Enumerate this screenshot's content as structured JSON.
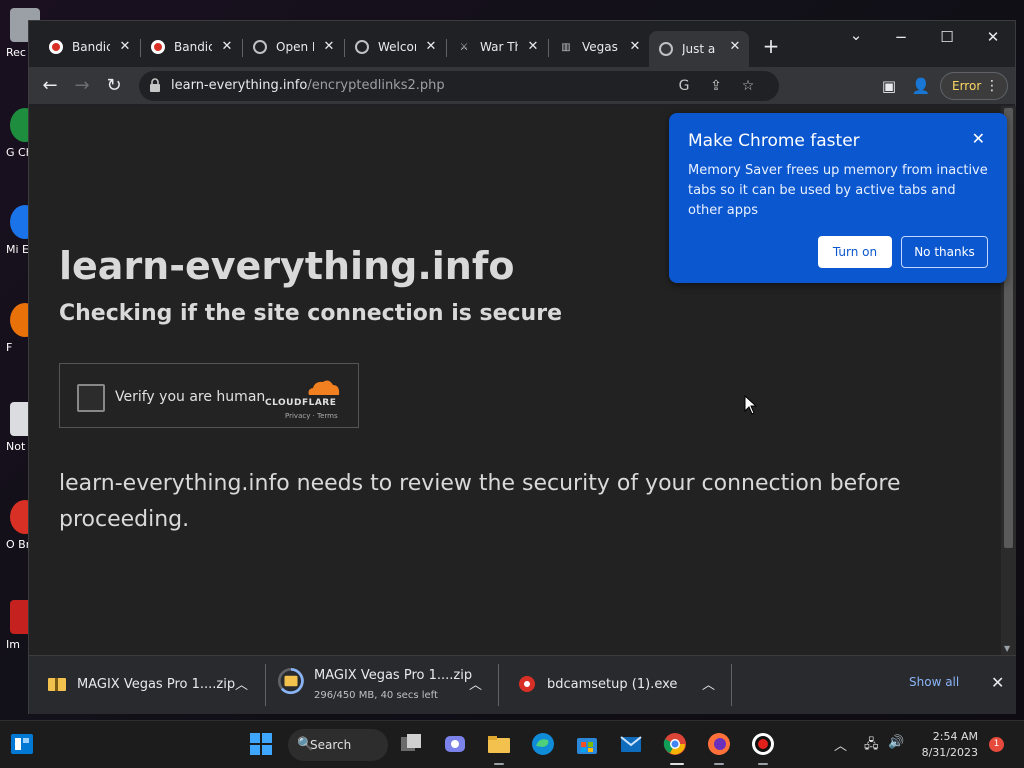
{
  "desktop": {
    "icons": [
      {
        "label": "Rec",
        "color": "#9aa0a6"
      },
      {
        "label": "G Ch",
        "color": "#1e8e3e"
      },
      {
        "label": "Mi E",
        "color": "#1a73e8"
      },
      {
        "label": "F",
        "color": "#e8710a"
      },
      {
        "label": "Not",
        "color": "#dadce0"
      },
      {
        "label": "O Br",
        "color": "#d93025"
      },
      {
        "label": "Im",
        "color": "#c5221f"
      }
    ]
  },
  "tabs": [
    {
      "title": "Bandic",
      "favicon": "record-icon",
      "color": "#d93025"
    },
    {
      "title": "Bandic",
      "favicon": "record-icon",
      "color": "#d93025"
    },
    {
      "title": "Open E",
      "favicon": "openai-icon",
      "color": "#bdc1c6"
    },
    {
      "title": "Welcon",
      "favicon": "globe-icon",
      "color": "#bdc1c6"
    },
    {
      "title": "War Th",
      "favicon": "sword-icon",
      "color": "#bdc1c6"
    },
    {
      "title": "Vegas",
      "favicon": "building-icon",
      "color": "#bdc1c6"
    },
    {
      "title": "Just a r",
      "favicon": "globe-icon",
      "color": "#bdc1c6",
      "active": true
    }
  ],
  "toolbar": {
    "url_host": "learn-everything.info",
    "url_path": "/encryptedlinks2.php",
    "error_label": "Error"
  },
  "page": {
    "title": "learn-everything.info",
    "subtitle": "Checking if the site connection is secure",
    "verify_label": "Verify you are human",
    "cloudflare_name": "CLOUDFLARE",
    "cloudflare_links": "Privacy  ·  Terms",
    "review_text": "learn-everything.info needs to review the security of your connection before proceeding."
  },
  "popup": {
    "title": "Make Chrome faster",
    "body": "Memory Saver frees up memory from inactive tabs so it can be used by active tabs and other apps",
    "turn_on": "Turn on",
    "no_thanks": "No thanks"
  },
  "downloads": {
    "items": [
      {
        "name": "MAGIX Vegas Pro 1....zip",
        "status": ""
      },
      {
        "name": "MAGIX Vegas Pro 1....zip",
        "status": "296/450 MB, 40 secs left"
      },
      {
        "name": "bdcamsetup (1).exe",
        "status": ""
      }
    ],
    "show_all": "Show all"
  },
  "taskbar": {
    "search_label": "Search",
    "time": "2:54 AM",
    "date": "8/31/2023",
    "notification_count": "1"
  }
}
